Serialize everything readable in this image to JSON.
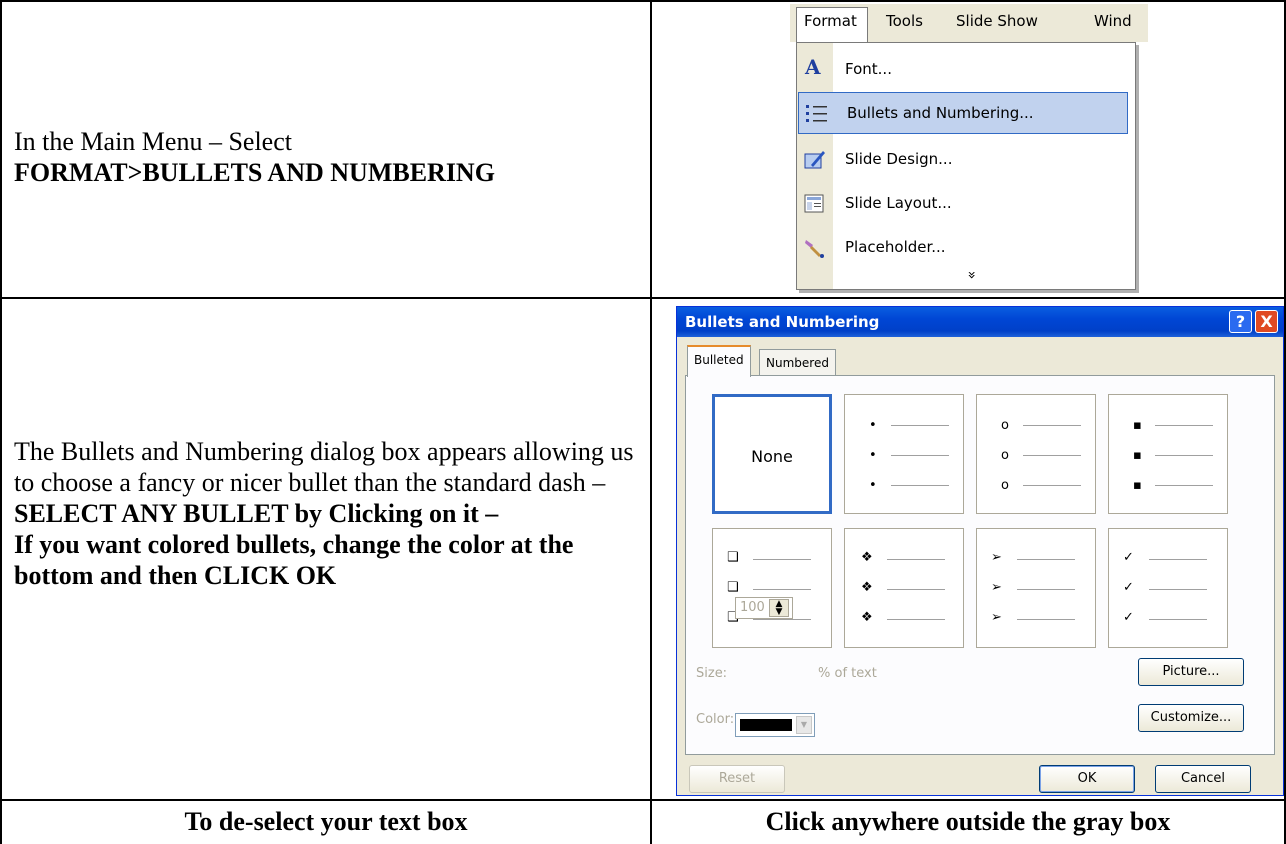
{
  "row1": {
    "intro": "In the Main Menu – Select",
    "command": "FORMAT>BULLETS AND NUMBERING"
  },
  "menu": {
    "bar": [
      "Format",
      "Tools",
      "Slide Show",
      "Wind"
    ],
    "items": [
      {
        "label": "Font...",
        "icon": "font-a-icon"
      },
      {
        "label": "Bullets and Numbering...",
        "icon": "bullets-list-icon",
        "selected": true
      },
      {
        "label": "Slide Design...",
        "icon": "slide-design-icon"
      },
      {
        "label": "Slide Layout...",
        "icon": "slide-layout-icon"
      },
      {
        "label": "Placeholder...",
        "icon": "placeholder-brush-icon"
      }
    ],
    "more": "»"
  },
  "row2": {
    "text_plain": "The Bullets and Numbering dialog box appears allowing us to choose a fancy or nicer bullet than the standard dash – ",
    "text_bold": "SELECT ANY BULLET by Clicking on it –",
    "text_bold2": "If you want colored bullets, change the color at the bottom and then CLICK OK"
  },
  "dialog": {
    "title": "Bullets and Numbering",
    "help": "?",
    "close": "X",
    "tabs": [
      "Bulleted",
      "Numbered"
    ],
    "none_label": "None",
    "tiles": [
      "None",
      "•",
      "o",
      "▪",
      "❑",
      "❖",
      "➢",
      "✓"
    ],
    "size_label": "Size:",
    "size_value": "100",
    "size_unit": "% of text",
    "color_label": "Color:",
    "color_value": "#000000",
    "buttons": {
      "picture": "Picture...",
      "customize": "Customize...",
      "reset": "Reset",
      "ok": "OK",
      "cancel": "Cancel"
    }
  },
  "row3": {
    "left": "To de-select your text box",
    "right": "Click anywhere outside the gray box"
  },
  "colors": {
    "title_bar": "#0046d5",
    "dialog_face": "#ece9d8",
    "menu_highlight": "#c1d2ee",
    "selected_tile_border": "#316ac5"
  }
}
